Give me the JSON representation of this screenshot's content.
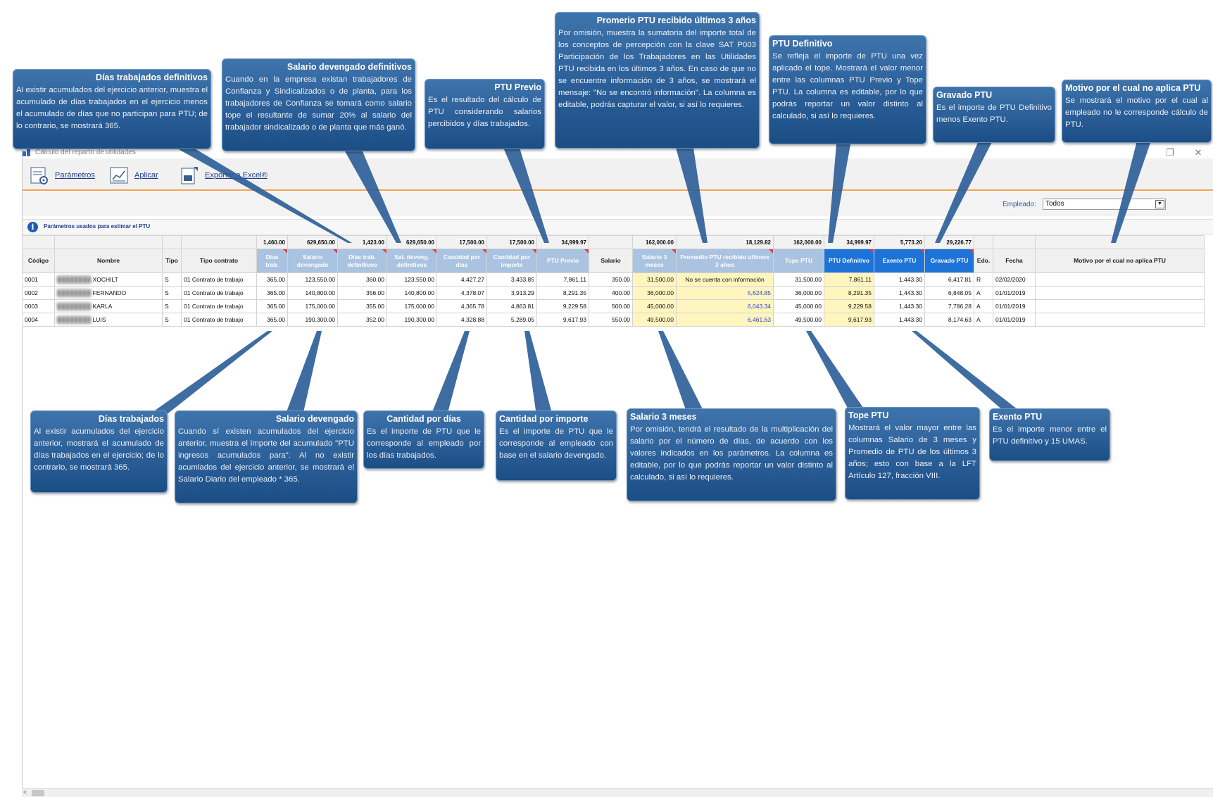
{
  "window": {
    "title": "Cálculo del reparto de utilidades",
    "buttons": {
      "minimize": "—",
      "restore": "❐",
      "close": "✕"
    }
  },
  "toolbar": {
    "parametros": "Parámetros",
    "aplicar": "Aplicar",
    "exportar": "Exportar a Excel®"
  },
  "filter": {
    "label": "Empleado:",
    "value": "Todos"
  },
  "info": {
    "text": "Parámetros usados para estimar el PTU"
  },
  "grid": {
    "totals": [
      "",
      "",
      "",
      "",
      "1,460.00",
      "629,650.00",
      "1,423.00",
      "629,650.00",
      "17,500.00",
      "17,500.00",
      "34,999.97",
      "",
      "162,000.00",
      "18,129.82",
      "162,000.00",
      "34,999.97",
      "5,773.20",
      "29,226.77",
      "",
      "",
      ""
    ],
    "headers": [
      "Código",
      "Nombre",
      "Tipo",
      "Tipo contrato",
      "Días trab.",
      "Salario devengado",
      "Días trab. definitivos",
      "Sal. deveng. definitivos",
      "Cantidad por días",
      "Cantidad por importe",
      "PTU Previo",
      "Salario",
      "Salario 3 meses",
      "Promedio PTU recibido últimos 3 años",
      "Tope PTU",
      "PTU Definitivo",
      "Exento PTU",
      "Gravado PTU",
      "Edo.",
      "Fecha",
      "Motivo por el cual no aplica PTU"
    ],
    "rows": [
      [
        "0001",
        "XOCHILT",
        "S",
        "01 Contrato de trabajo",
        "365.00",
        "123,550.00",
        "360.00",
        "123,550.00",
        "4,427.27",
        "3,433.85",
        "7,861.11",
        "350.00",
        "31,500.00",
        "No se cuenta con información",
        "31,500.00",
        "7,861.11",
        "1,443.30",
        "6,417.81",
        "R",
        "02/02/2020",
        ""
      ],
      [
        "0002",
        "FERNANDO",
        "S",
        "01 Contrato de trabajo",
        "365.00",
        "140,800.00",
        "356.00",
        "140,800.00",
        "4,378.07",
        "3,913.29",
        "8,291.35",
        "400.00",
        "36,000.00",
        "5,624.85",
        "36,000.00",
        "8,291.35",
        "1,443.30",
        "6,848.05",
        "A",
        "01/01/2019",
        ""
      ],
      [
        "0003",
        "KARLA",
        "S",
        "01 Contrato de trabajo",
        "365.00",
        "175,000.00",
        "355.00",
        "175,000.00",
        "4,365.78",
        "4,863.81",
        "9,229.58",
        "500.00",
        "45,000.00",
        "6,043.34",
        "45,000.00",
        "9,229.58",
        "1,443.30",
        "7,786.28",
        "A",
        "01/01/2019",
        ""
      ],
      [
        "0004",
        "LUIS",
        "S",
        "01 Contrato de trabajo",
        "365.00",
        "190,300.00",
        "352.00",
        "190,300.00",
        "4,328.88",
        "5,289.05",
        "9,617.93",
        "550.00",
        "49,500.00",
        "6,461.63",
        "49,500.00",
        "9,617.93",
        "1,443.30",
        "8,174.63",
        "A",
        "01/01/2019",
        ""
      ]
    ]
  },
  "callouts": {
    "dias_def": {
      "title": "Días trabajados definitivos",
      "body": "Al existir acumulados del ejercicio anterior, muestra el acumulado de días trabajados en el ejercicio menos el acumulado de días que no participan para PTU; de lo contrario, se mostrará 365."
    },
    "sal_def": {
      "title": "Salario devengado definitivos",
      "body": "Cuando en la empresa existan trabajadores de Confianza y Sindicalizados o de planta, para los trabajadores de Confianza se tomará como salario tope el resultante de sumar 20% al salario del trabajador sindicalizado o de planta que más ganó."
    },
    "ptu_previo": {
      "title": "PTU Previo",
      "body": "Es el resultado del cálculo de PTU considerando salarios percibidos y días trabajados."
    },
    "promedio": {
      "title": "Promerio PTU recibido últimos 3 años",
      "body": "Por omisión, muestra la sumatoria del importe total de los conceptos de percepción con la clave SAT P003 Participación de los Trabajadores en las Utilidades PTU recibida en los últimos 3 años. En caso de que no se encuentre información de 3 años, se mostrará el mensaje: \"No se encontró información\". La columna es editable, podrás capturar el valor, si así lo requieres."
    },
    "ptu_def": {
      "title": "PTU Definitivo",
      "body": "Se refleja el importe de PTU una vez aplicado el tope. Mostrará el valor menor entre las columnas PTU Previo y Tope PTU. La columna es editable, por lo que podrás reportar un valor distinto al calculado, si así lo requieres."
    },
    "gravado": {
      "title": "Gravado PTU",
      "body": "Es el importe de PTU Definitivo menos Exento PTU."
    },
    "motivo": {
      "title": "Motivo por el cual no aplica PTU",
      "body": "Se mostrará el motivo por el cual al empleado no le corresponde cálculo de PTU."
    },
    "dias": {
      "title": "Días trabajados",
      "body": "Al existir acumulados del ejercicio anterior, mostrará el acumulado de días trabajados en el ejercicio; de lo contrario, se mostrará 365."
    },
    "sal_dev": {
      "title": "Salario devengado",
      "body": "Cuando sí existen acumulados del ejercicio anterior, muestra el importe del acumulado \"PTU ingresos acumulados para\". Al no existir acumlados del ejercicio anterior, se mostrará el Salario Diario del empleado * 365."
    },
    "cant_dias": {
      "title": "Cantidad por días",
      "body": "Es el importe de PTU que le corresponde al empleado por los días trabajados."
    },
    "cant_imp": {
      "title": "Cantidad por importe",
      "body": "Es el importe de PTU que le corresponde al empleado con base en el salario devengado."
    },
    "sal3": {
      "title": "Salario 3 meses",
      "body": "Por omisión, tendrá el resultado de la multiplicación del salario por el número de días, de acuerdo con los valores indicados en los parámetros. La columna es editable, por lo que podrás reportar un valor distinto al calculado, si así lo requieres."
    },
    "tope": {
      "title": "Tope PTU",
      "body": "Mostrará el valor mayor entre las columnas Salario de 3 meses y Promedio de PTU de los últimos 3 años; esto con base a la LFT Artículo 127, fracción VIII."
    },
    "exento": {
      "title": "Exento PTU",
      "body": "Es el importe menor entre el PTU definitivo y 15 UMAS."
    }
  },
  "colors": {
    "callout": "#2a5d97",
    "header_blue": "#aac3e0",
    "header_dark": "#1e73d8",
    "editable": "#fff6bf",
    "accent_line": "#f4a35a"
  }
}
